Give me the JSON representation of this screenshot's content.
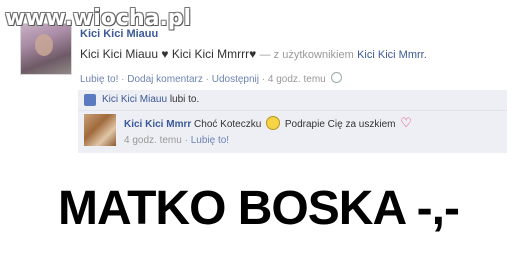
{
  "watermark": "www.wiocha.pl",
  "post": {
    "author_cut": "Kici Kici Miauu",
    "status_text": "Kici Kici Miauu ♥ Kici Kici Mmrrr♥",
    "with_text": "— z użytkownikiem",
    "with_name": "Kici Kici Mmrr.",
    "actions": {
      "like": "Lubię to!",
      "comment": "Dodaj komentarz",
      "share": "Udostępnij",
      "time": "4 godz. temu"
    },
    "likes": {
      "name": "Kici Kici Miauu",
      "text": "lubi to."
    },
    "comment": {
      "author": "Kici Kici Mmrr",
      "text_before": "Choć Koteczku",
      "text_after": "Podrapie Cię za uszkiem",
      "time": "4 godz. temu",
      "like": "Lubię to!"
    }
  },
  "caption": "MATKO BOSKA -,-"
}
